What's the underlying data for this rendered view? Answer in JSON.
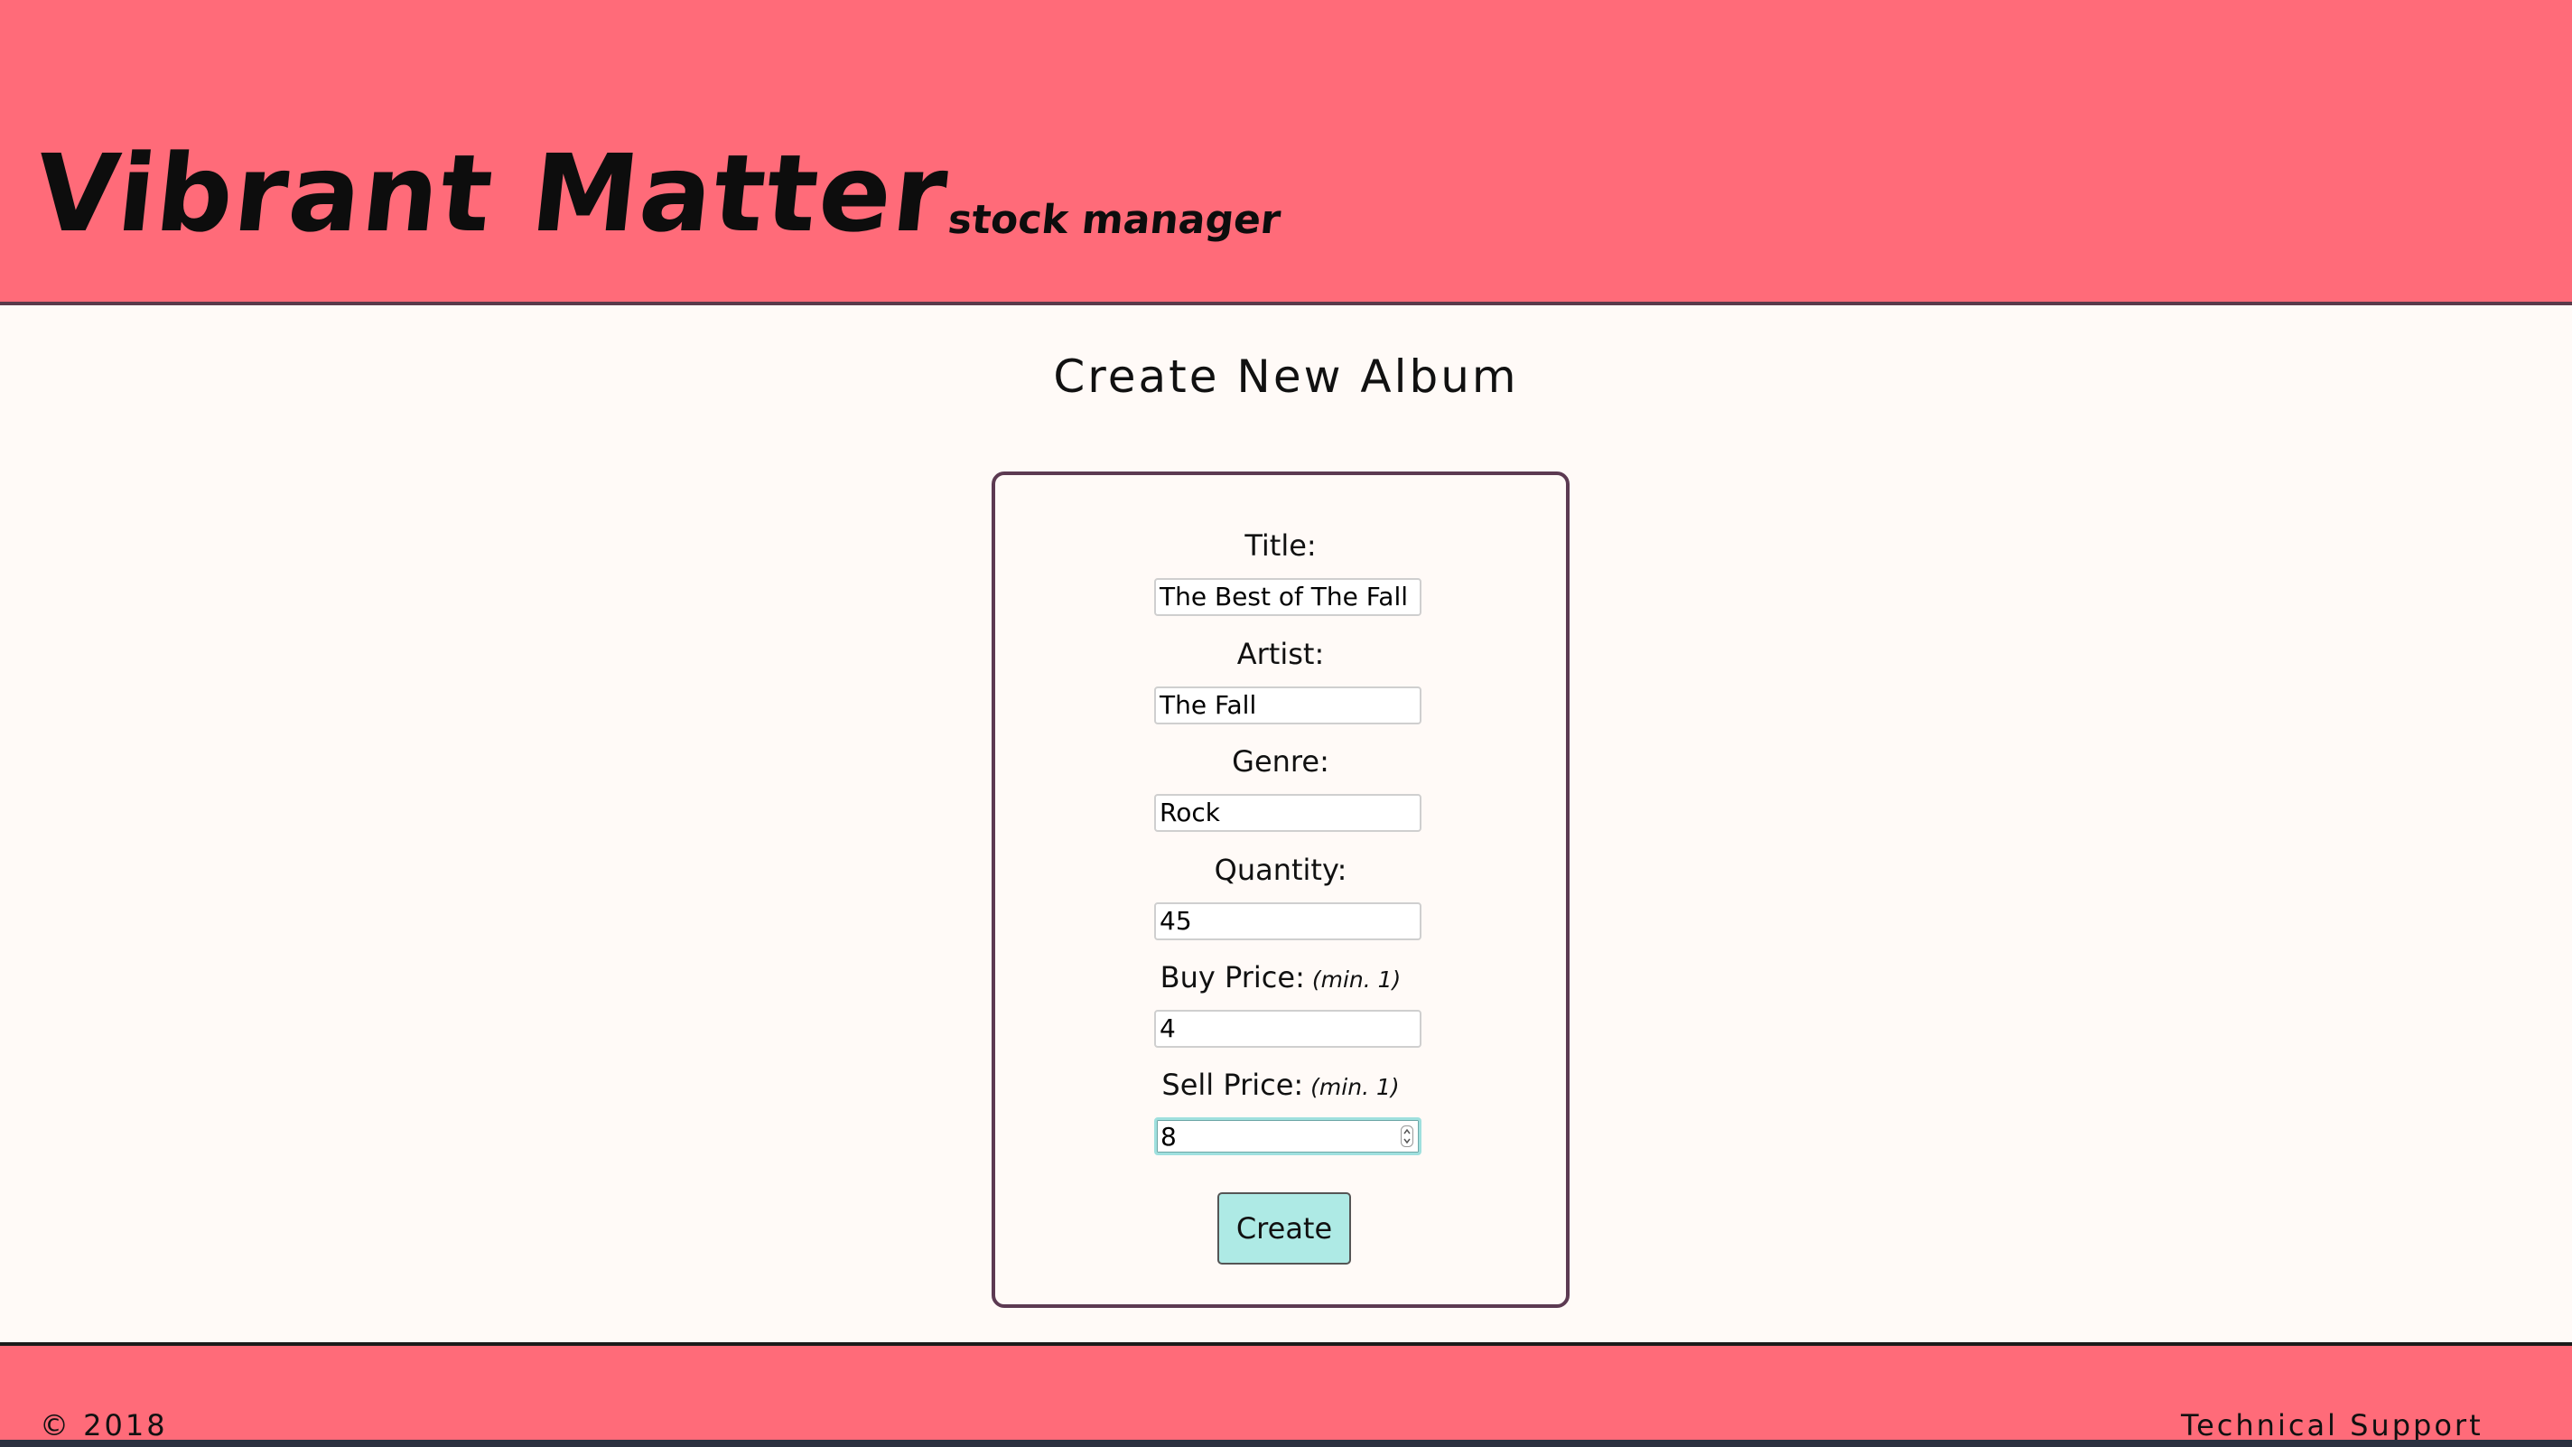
{
  "header": {
    "brand": "Vibrant Matter",
    "tagline": "stock manager"
  },
  "main": {
    "title": "Create New Album",
    "form": {
      "fields": [
        {
          "label": "Title:",
          "hint": "",
          "value": "The Best of The Fall"
        },
        {
          "label": "Artist:",
          "hint": "",
          "value": "The Fall"
        },
        {
          "label": "Genre:",
          "hint": "",
          "value": "Rock"
        },
        {
          "label": "Quantity:",
          "hint": "",
          "value": "45"
        },
        {
          "label": "Buy Price:",
          "hint": "(min. 1)",
          "value": "4"
        },
        {
          "label": "Sell Price:",
          "hint": "(min. 1)",
          "value": "8"
        }
      ],
      "submit_label": "Create"
    }
  },
  "footer": {
    "copyright": "© 2018",
    "support_link": "Technical Support"
  },
  "colors": {
    "header_background": "#ff6b79",
    "page_background": "#fffaf7",
    "button_background": "#aeeae5",
    "card_border": "#5c3a52"
  },
  "icons": {
    "number_spinner": "spinner-arrows-icon"
  }
}
